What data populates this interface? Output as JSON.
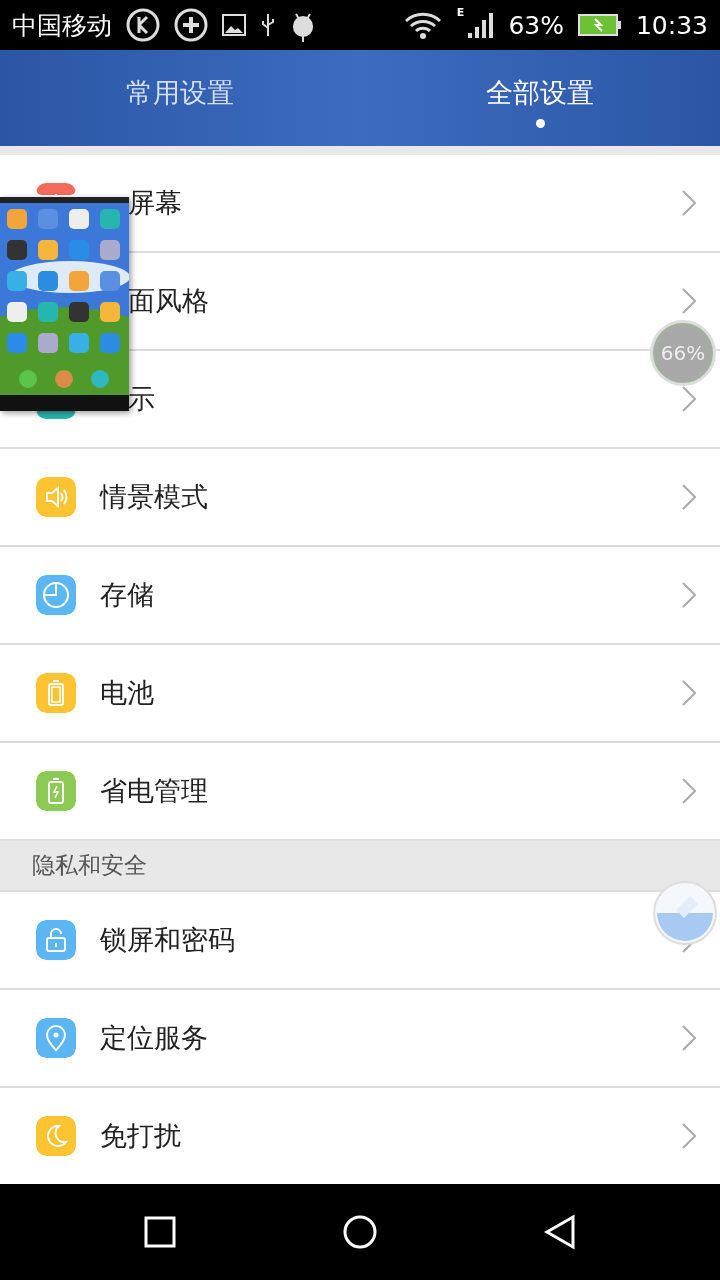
{
  "status_bar": {
    "carrier": "中国移动",
    "battery": "63%",
    "time": "10:33",
    "network": "E"
  },
  "tabs": [
    {
      "label": "常用设置",
      "selected": false
    },
    {
      "label": "全部设置",
      "selected": true
    }
  ],
  "items": [
    {
      "kind": "partial",
      "label": "屏幕",
      "color": "#f26b5b"
    },
    {
      "kind": "partial",
      "label": "面风格"
    },
    {
      "kind": "partial",
      "label": "示",
      "color": "#2bb5ad"
    },
    {
      "kind": "full",
      "label": "情景模式",
      "color": "#fcc431"
    },
    {
      "kind": "full",
      "label": "存储",
      "color": "#5cb6f2"
    },
    {
      "kind": "full",
      "label": "电池",
      "color": "#fcc431"
    },
    {
      "kind": "full",
      "label": "省电管理",
      "color": "#8cc955"
    },
    {
      "kind": "section",
      "label": "隐私和安全"
    },
    {
      "kind": "full",
      "label": "锁屏和密码",
      "color": "#5cb6f2"
    },
    {
      "kind": "full",
      "label": "定位服务",
      "color": "#5cb6f2"
    },
    {
      "kind": "full",
      "label": "免打扰",
      "color": "#fcc431"
    }
  ],
  "memory_ball": {
    "reading": "66%"
  }
}
